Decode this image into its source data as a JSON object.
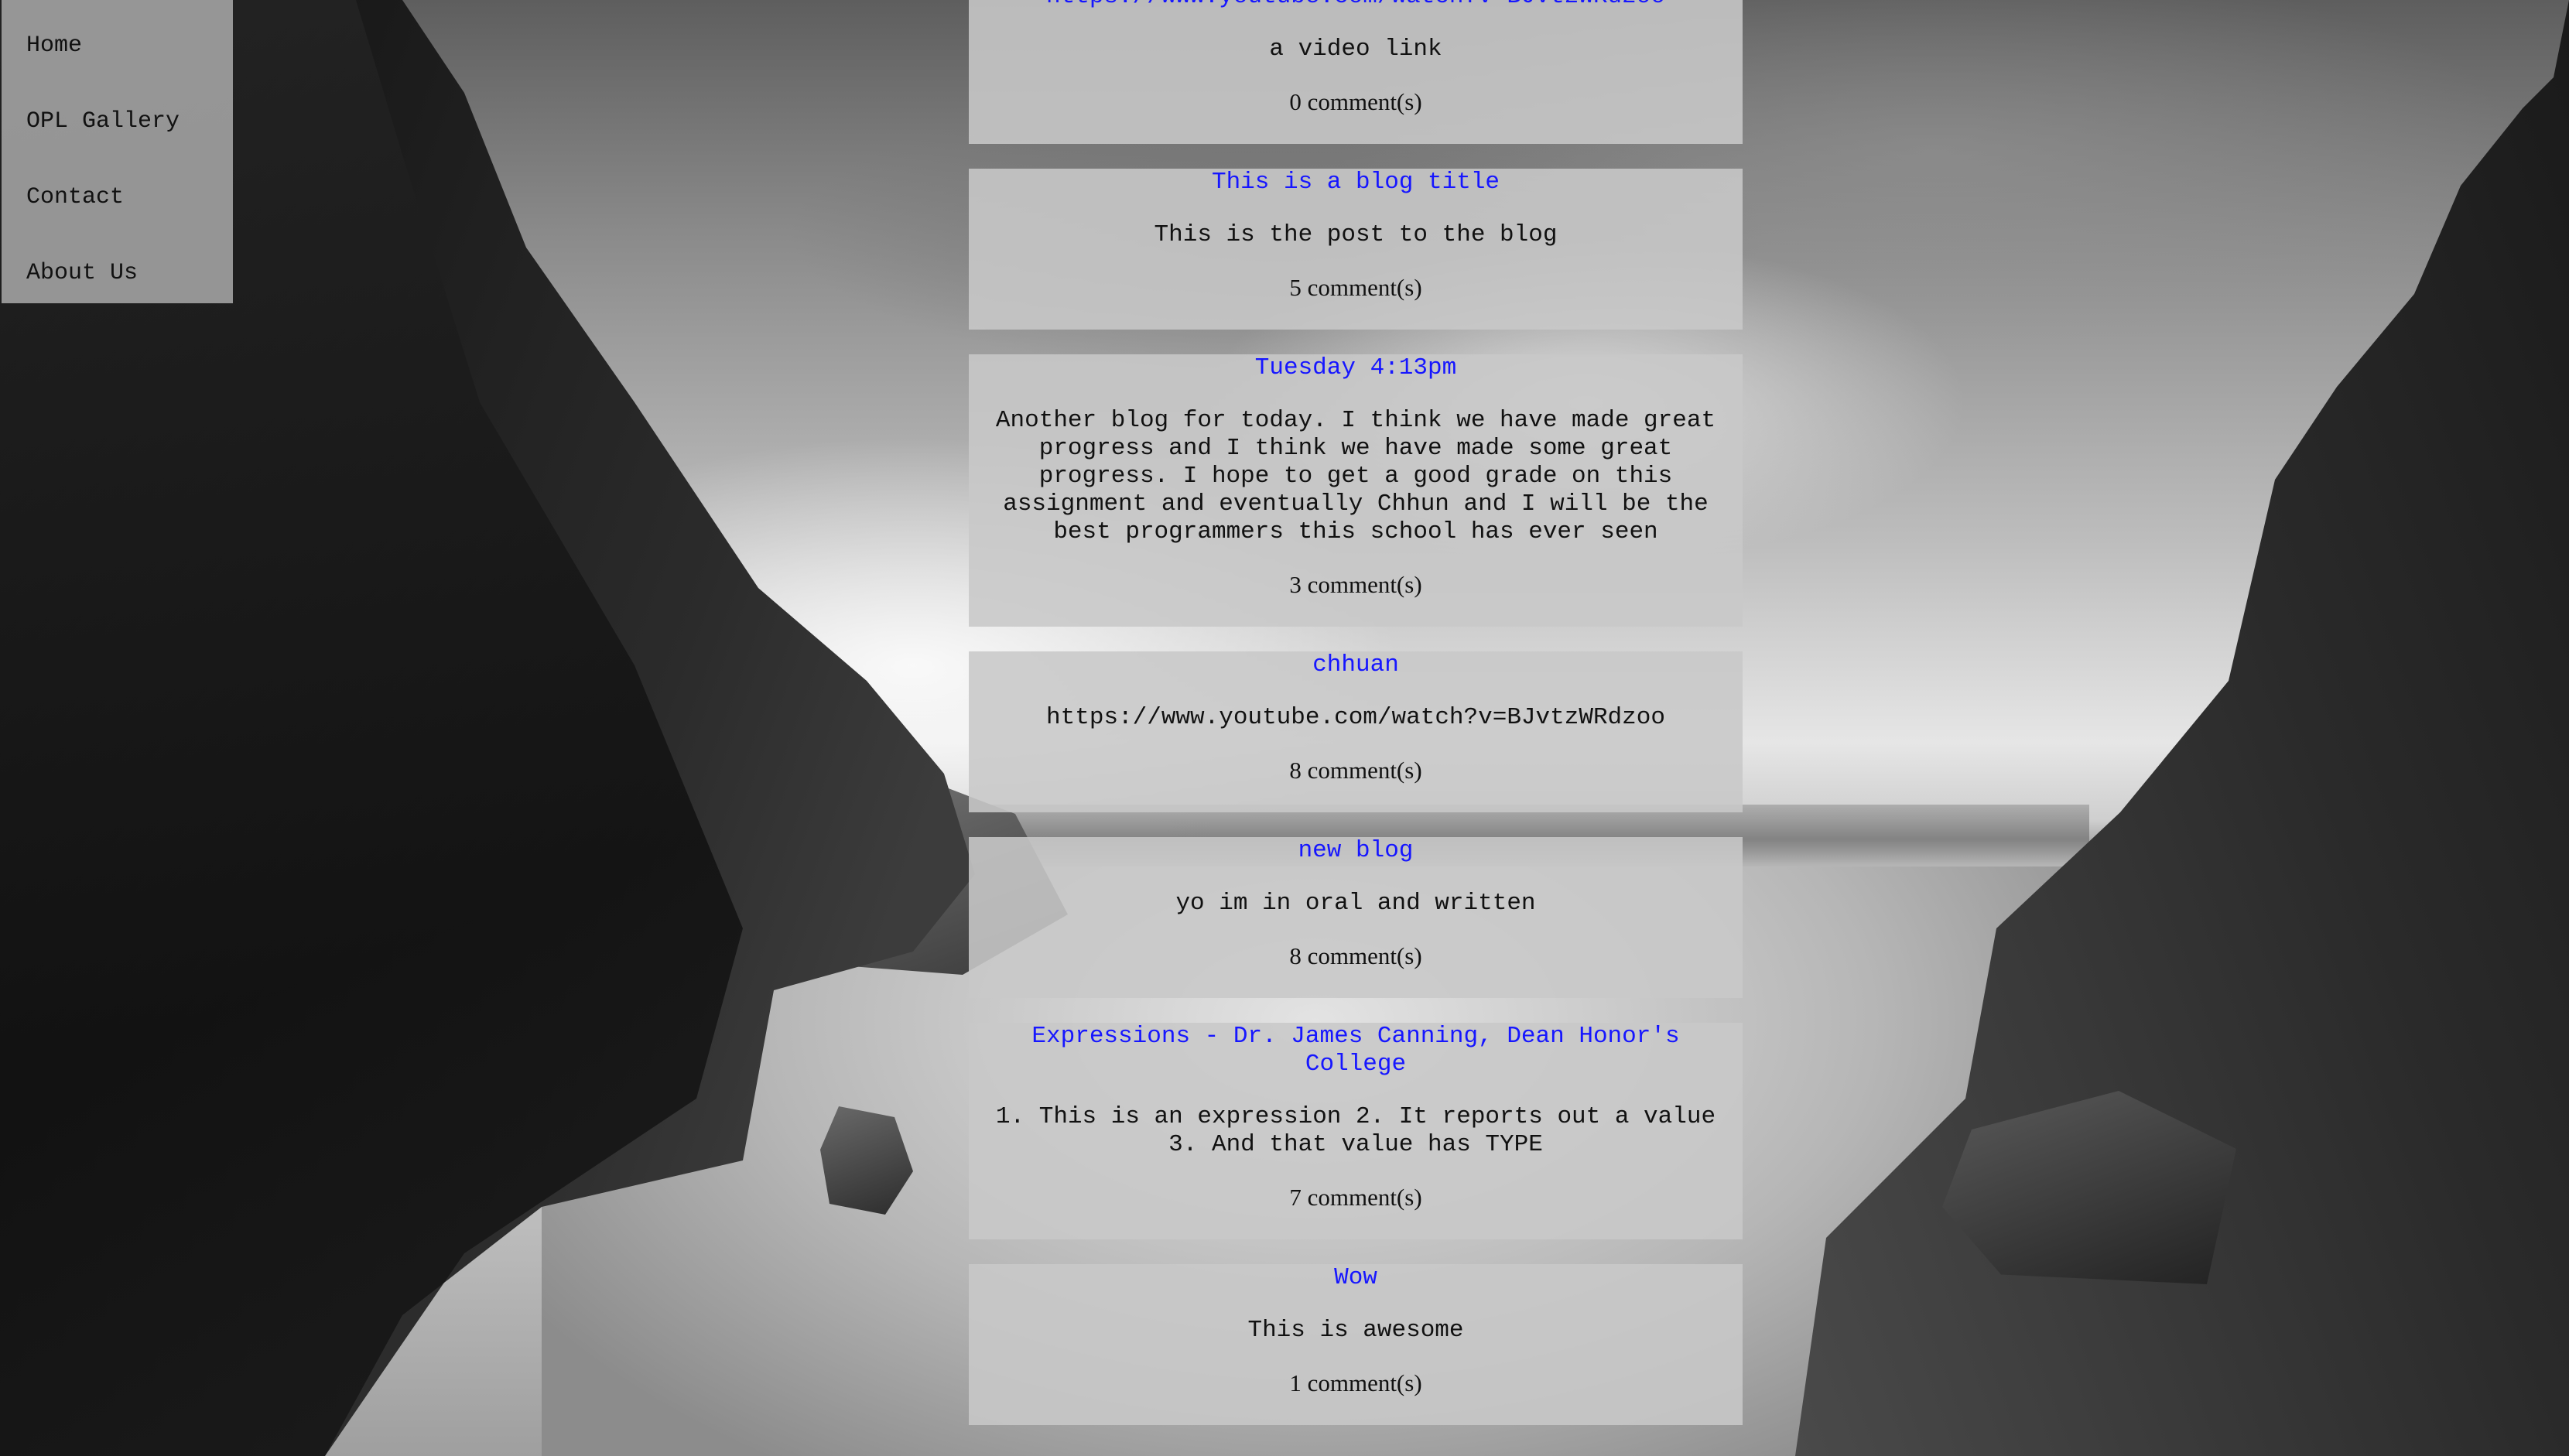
{
  "nav": {
    "items": [
      {
        "label": "Home"
      },
      {
        "label": "OPL Gallery"
      },
      {
        "label": "Contact"
      },
      {
        "label": "About Us"
      }
    ]
  },
  "posts": [
    {
      "title": "https://www.youtube.com/watch?v=BJvtzWRdzoo",
      "body": "a video link",
      "comments": "0 comment(s)"
    },
    {
      "title": "This is a blog title",
      "body": "This is the post to the blog",
      "comments": "5 comment(s)"
    },
    {
      "title": "Tuesday 4:13pm",
      "body": "Another blog for today. I think we have made great progress and I think we have made some great progress. I hope to get a good grade on this assignment and eventually Chhun and I will be the best programmers this school has ever seen",
      "comments": "3 comment(s)"
    },
    {
      "title": "chhuan",
      "body": "https://www.youtube.com/watch?v=BJvtzWRdzoo",
      "comments": "8 comment(s)"
    },
    {
      "title": "new blog",
      "body": "yo im in oral and written",
      "comments": "8 comment(s)"
    },
    {
      "title": "Expressions - Dr. James Canning, Dean Honor's College",
      "body": "1. This is an expression 2. It reports out a value 3. And that value has TYPE",
      "comments": "7 comment(s)"
    },
    {
      "title": "Wow",
      "body": "This is awesome",
      "comments": "1 comment(s)"
    }
  ]
}
